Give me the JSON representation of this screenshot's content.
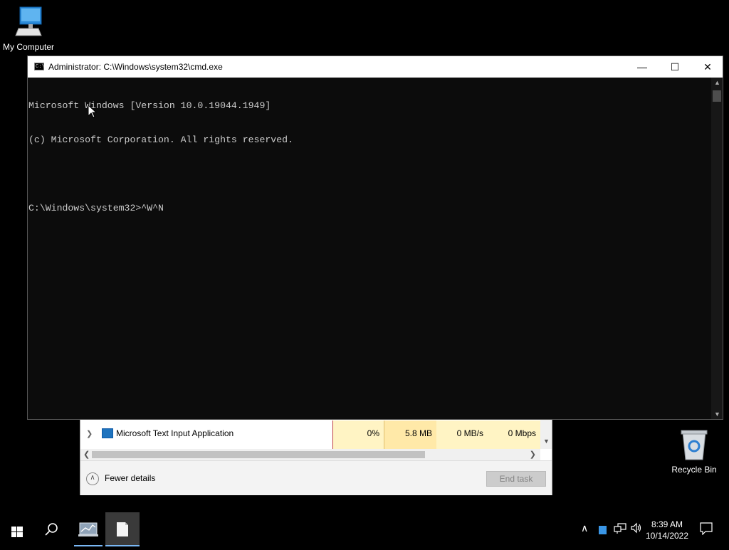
{
  "desktop": {
    "icons": [
      {
        "label": "My Computer"
      },
      {
        "label": "Recycle Bin"
      }
    ]
  },
  "cmd": {
    "title": "Administrator: C:\\Windows\\system32\\cmd.exe",
    "lines": [
      "Microsoft Windows [Version 10.0.19044.1949]",
      "(c) Microsoft Corporation. All rights reserved.",
      "",
      "C:\\Windows\\system32>^W^N"
    ],
    "controls": {
      "minimize": "—",
      "maximize": "☐",
      "close": "✕"
    }
  },
  "task_manager": {
    "row": {
      "name": "Microsoft Text Input Application",
      "cpu": "0%",
      "memory": "5.8 MB",
      "disk": "0 MB/s",
      "network": "0 Mbps"
    },
    "fewer_details_label": "Fewer details",
    "end_task_label": "End task"
  },
  "taskbar": {
    "time": "8:39 AM",
    "date": "10/14/2022"
  },
  "colors": {
    "console_bg": "#0c0c0c",
    "console_text": "#cccccc",
    "cpu_highlight": "#fff4c4",
    "memory_highlight": "#ffe9a8"
  }
}
